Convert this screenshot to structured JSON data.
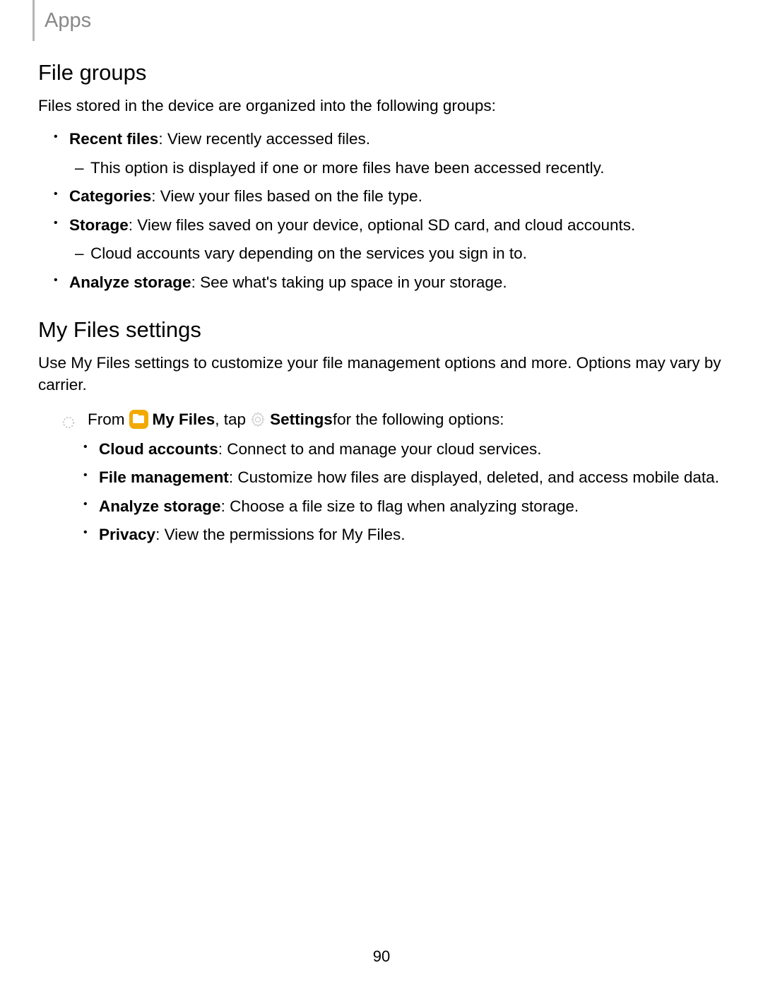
{
  "header": {
    "label": "Apps"
  },
  "section1": {
    "title": "File groups",
    "intro": "Files stored in the device are organized into the following groups:",
    "items": [
      {
        "label": "Recent files",
        "desc": ": View recently accessed files.",
        "sub": "This option is displayed if one or more files have been accessed recently."
      },
      {
        "label": "Categories",
        "desc": ": View your files based on the file type."
      },
      {
        "label": "Storage",
        "desc": ": View files saved on your device, optional SD card, and cloud accounts.",
        "sub": "Cloud accounts vary depending on the services you sign in to."
      },
      {
        "label": "Analyze storage",
        "desc": ": See what's taking up space in your storage."
      }
    ]
  },
  "section2": {
    "title": "My Files settings",
    "intro": "Use My Files settings to customize your file management options and more. Options may vary by carrier.",
    "instruction": {
      "pre": "From",
      "app_label": "My Files",
      "middle": ", tap",
      "action_label": "Settings",
      "post": " for the following options:"
    },
    "options": [
      {
        "label": "Cloud accounts",
        "desc": ": Connect to and manage your cloud services."
      },
      {
        "label": "File management",
        "desc": ": Customize how files are displayed, deleted, and access mobile data."
      },
      {
        "label": "Analyze storage",
        "desc": ": Choose a file size to flag when analyzing storage."
      },
      {
        "label": "Privacy",
        "desc": ": View the permissions for My Files."
      }
    ]
  },
  "page_number": "90"
}
